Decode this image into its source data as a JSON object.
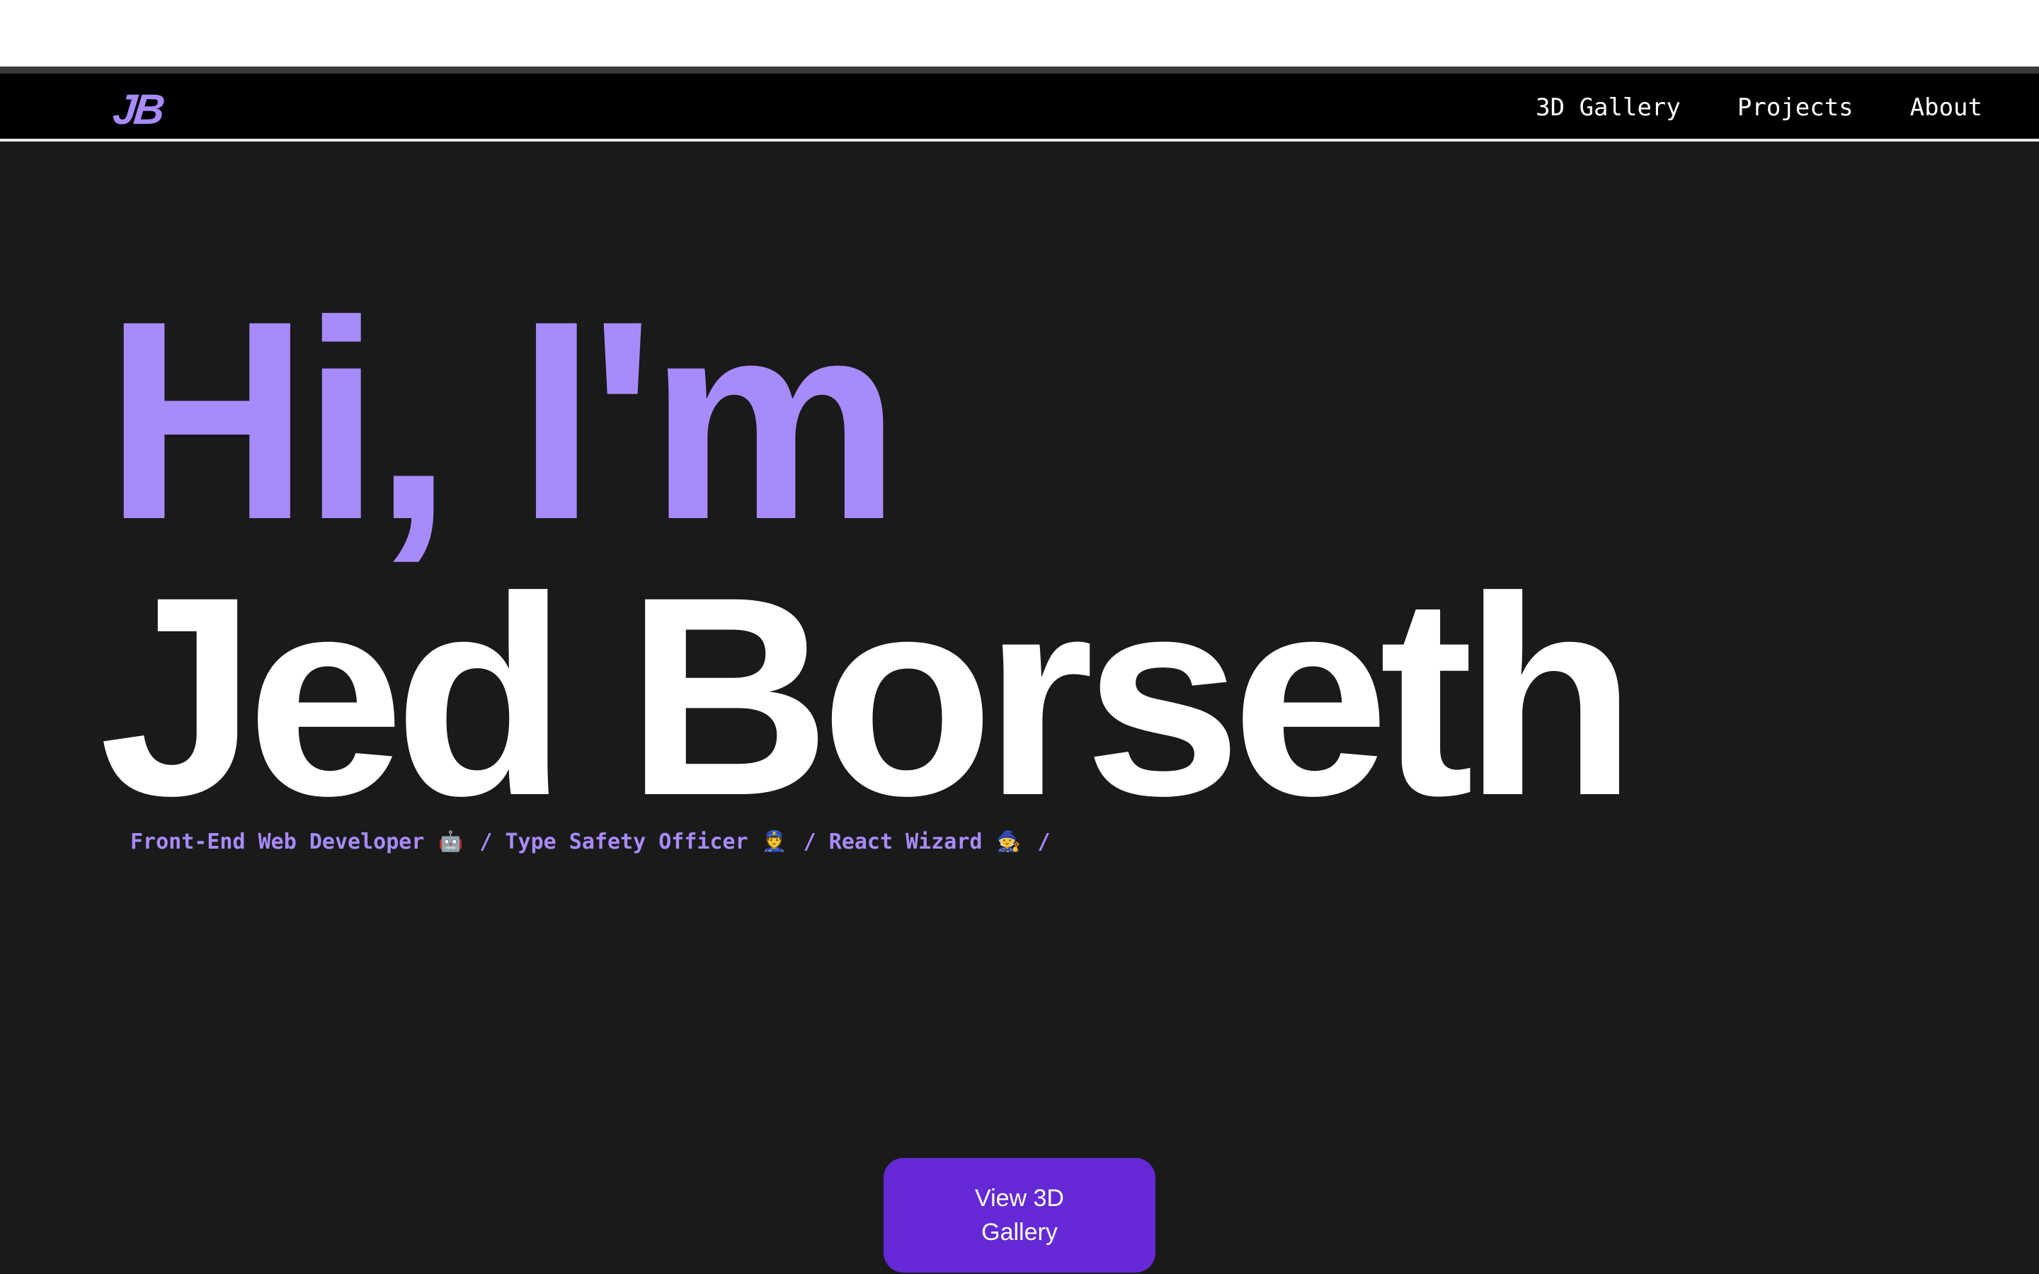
{
  "nav": {
    "logo": "JB",
    "links": [
      "3D Gallery",
      "Projects",
      "About"
    ]
  },
  "hero": {
    "greeting": "Hi, I'm",
    "name": "Jed Borseth"
  },
  "tagline": {
    "roles": [
      {
        "label": "Front-End Web Developer",
        "icon": "robot-icon",
        "emoji": "🤖"
      },
      {
        "label": "Type Safety Officer",
        "icon": "police-officer-icon",
        "emoji": "👮"
      },
      {
        "label": "React Wizard",
        "icon": "wizard-icon",
        "emoji": "🧙"
      }
    ],
    "separator": "/"
  },
  "cta": {
    "label": "View 3D Gallery"
  },
  "colors": {
    "accent": "#a78bfa",
    "button": "#6429d4",
    "background": "#1a1a1a",
    "navbar": "#000000"
  }
}
